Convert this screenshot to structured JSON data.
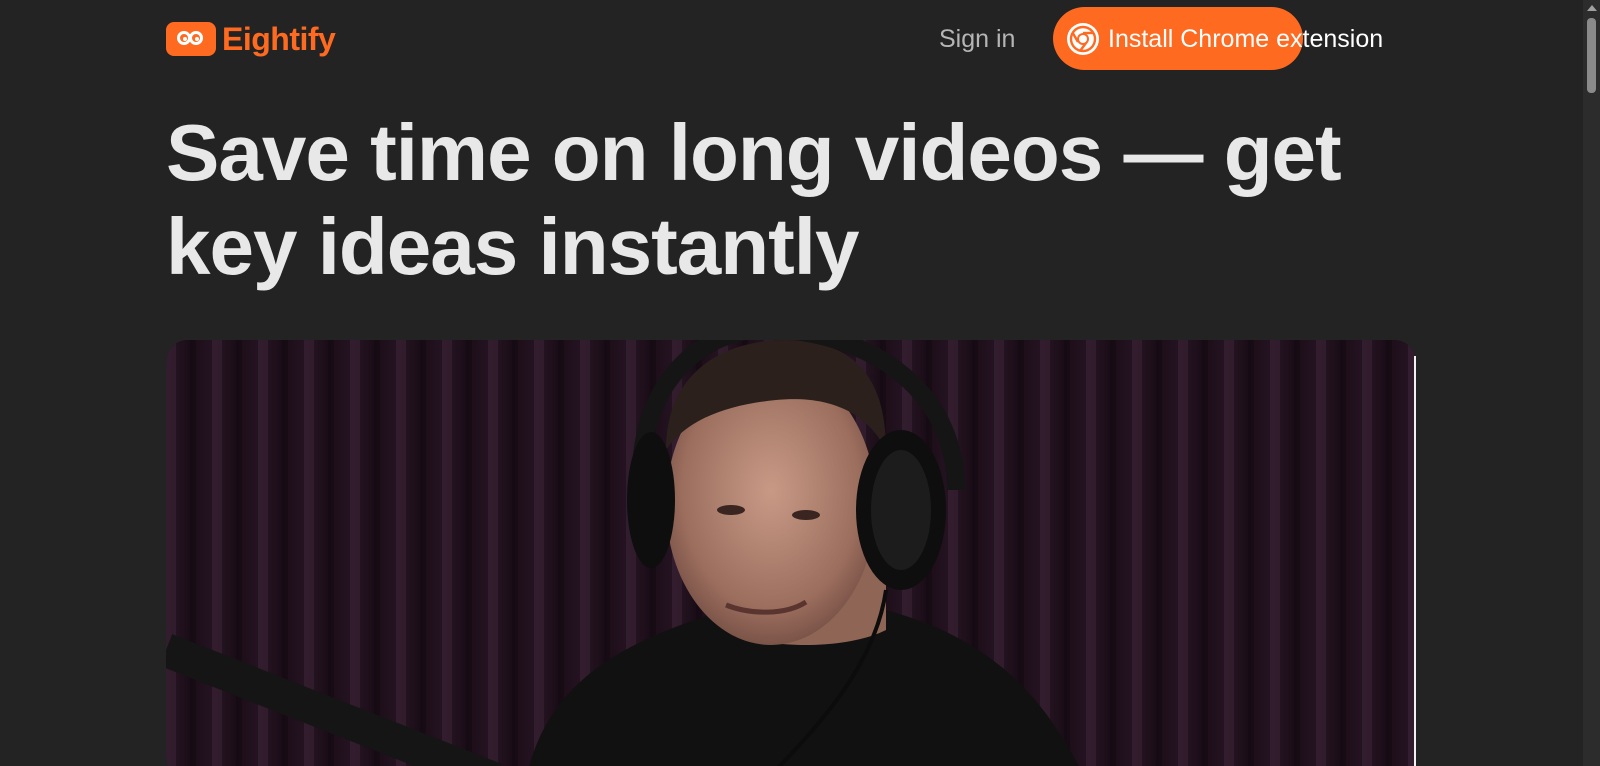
{
  "brand": {
    "name": "Eightify",
    "accent_color": "#ff6a21"
  },
  "header": {
    "signin_label": "Sign in",
    "install_label": "Install Chrome extension",
    "install_icon": "chrome-logo-icon"
  },
  "hero": {
    "headline": "Save time on long videos — get key ideas instantly"
  },
  "video": {
    "thumbnail": "podcast-guest-with-headphones-image"
  }
}
